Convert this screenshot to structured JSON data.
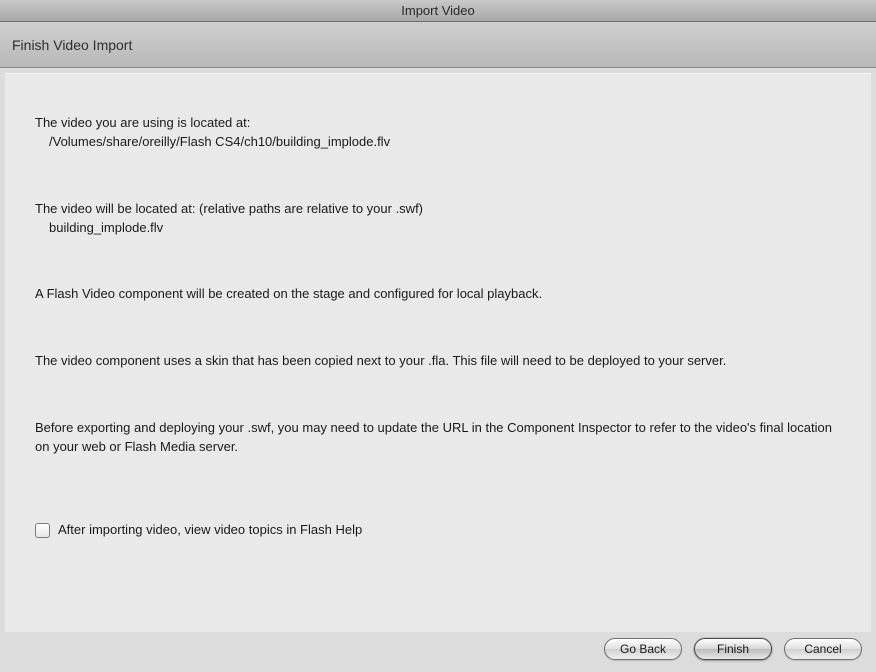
{
  "window": {
    "title": "Import Video"
  },
  "subheader": {
    "title": "Finish Video Import"
  },
  "content": {
    "located_label": "The video you are using is located at:",
    "located_path": "/Volumes/share/oreilly/Flash CS4/ch10/building_implode.flv",
    "willbe_label": "The video will be located at: (relative paths are relative to your .swf)",
    "willbe_path": "building_implode.flv",
    "component_text": "A Flash Video component will be created on the stage and configured for local playback.",
    "skin_text": "The video component uses a skin that has been copied next to your .fla. This file will need to be deployed to your server.",
    "export_text": "Before exporting and deploying your .swf, you may need to update the URL in the Component Inspector to refer to the video's final location on your web or Flash Media server.",
    "checkbox_label": "After importing video, view video topics in Flash Help",
    "checkbox_checked": false
  },
  "buttons": {
    "back": "Go Back",
    "finish": "Finish",
    "cancel": "Cancel"
  }
}
